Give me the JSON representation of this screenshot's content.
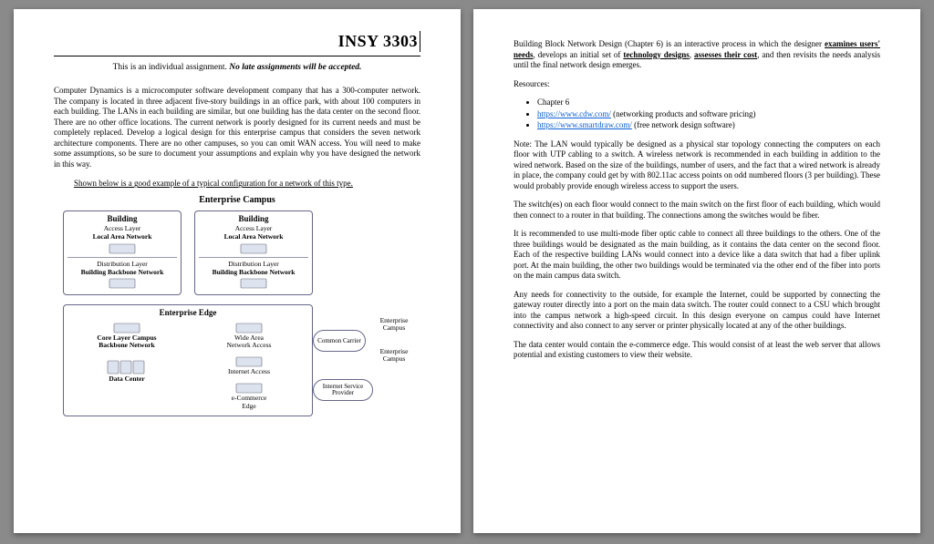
{
  "page1": {
    "course": "INSY 3303",
    "subtitle_prefix": "This is an individual assignment. ",
    "subtitle_bold": "No late assignments will be accepted.",
    "para1": "Computer Dynamics is a microcomputer software development company that has a 300-computer network. The company is located in three adjacent five-story buildings in an office park, with about 100 computers in each building. The LANs in each building are similar, but one building has the data center on the second floor. There are no other office locations. The current network is poorly designed for its current needs and must be completely replaced. Develop a logical design for this enterprise campus that considers the seven network architecture components. There are no other campuses, so you can omit WAN access. You will need to make some assumptions, so be sure to document your assumptions and explain why you have designed the network in this way.",
    "caption": "Shown below is a good example of a typical configuration for a network of this type.",
    "diagram": {
      "title": "Enterprise Campus",
      "building_hdr": "Building",
      "access_layer": "Access Layer",
      "lan": "Local Area Network",
      "dist_layer": "Distribution Layer",
      "bbn": "Building Backbone Network",
      "edge_hdr": "Enterprise Edge",
      "core1": "Core Layer Campus",
      "core2": "Backbone Network",
      "wan": "Wide Area",
      "wan2": "Network Access",
      "internet": "Internet Access",
      "datacenter": "Data Center",
      "ecom": "e-Commerce",
      "ecom2": "Edge",
      "cloud_common": "Common Carrier",
      "cloud_isp": "Internet Service Provider",
      "lbl_ec": "Enterprise Campus",
      "lbl_ec2": "Enterprise Campus"
    }
  },
  "page2": {
    "intro_a": "Building Block Network Design (Chapter 6) is an interactive process in which the designer ",
    "intro_b": "examines users' needs",
    "intro_c": ", develops an initial set of ",
    "intro_d": "technology designs",
    "intro_e": ", ",
    "intro_f": "assesses their cost",
    "intro_g": ", and then revisits the needs analysis until the final network design emerges.",
    "resources_label": "Resources:",
    "res1": "Chapter 6",
    "res2_href": "https://www.cdw.com/",
    "res2_note": " (networking products and software pricing)",
    "res3_href": "https://www.smartdraw.com/",
    "res3_note": " (free network design software)",
    "note": "Note: The LAN would typically be designed as a physical star topology connecting the computers on each floor with UTP cabling to a switch. A wireless network is recommended in each building in addition to the wired network. Based on the size of the buildings, number of users, and the fact that a wired network is already in place, the company could get by with 802.11ac access points on odd numbered floors (3 per building). These would probably provide enough wireless access to support the users.",
    "p2": "The switch(es) on each floor would connect to the main switch on the first floor of each building, which would then connect to a router in that building. The connections among the switches would be fiber.",
    "p3": "It is recommended to use multi-mode fiber optic cable to connect all three buildings to the others. One of the three buildings would be designated as the main building, as it contains the data center on the second floor. Each of the respective building LANs would connect into a device like a data switch that had a fiber uplink port.  At the main building, the other two buildings would be terminated via the other end of the fiber into ports on the main campus data switch.",
    "p4": "Any needs for connectivity to the outside, for example the Internet, could be supported by connecting the gateway router directly into a port on the main data switch. The router could connect to a CSU which brought into the campus network a high-speed circuit.  In this design everyone on campus could have Internet connectivity and also connect to any server or printer physically located at any of the other buildings.",
    "p5": "The data center would contain the e-commerce edge. This would consist of at least the web server that allows potential and existing customers to view their website."
  }
}
